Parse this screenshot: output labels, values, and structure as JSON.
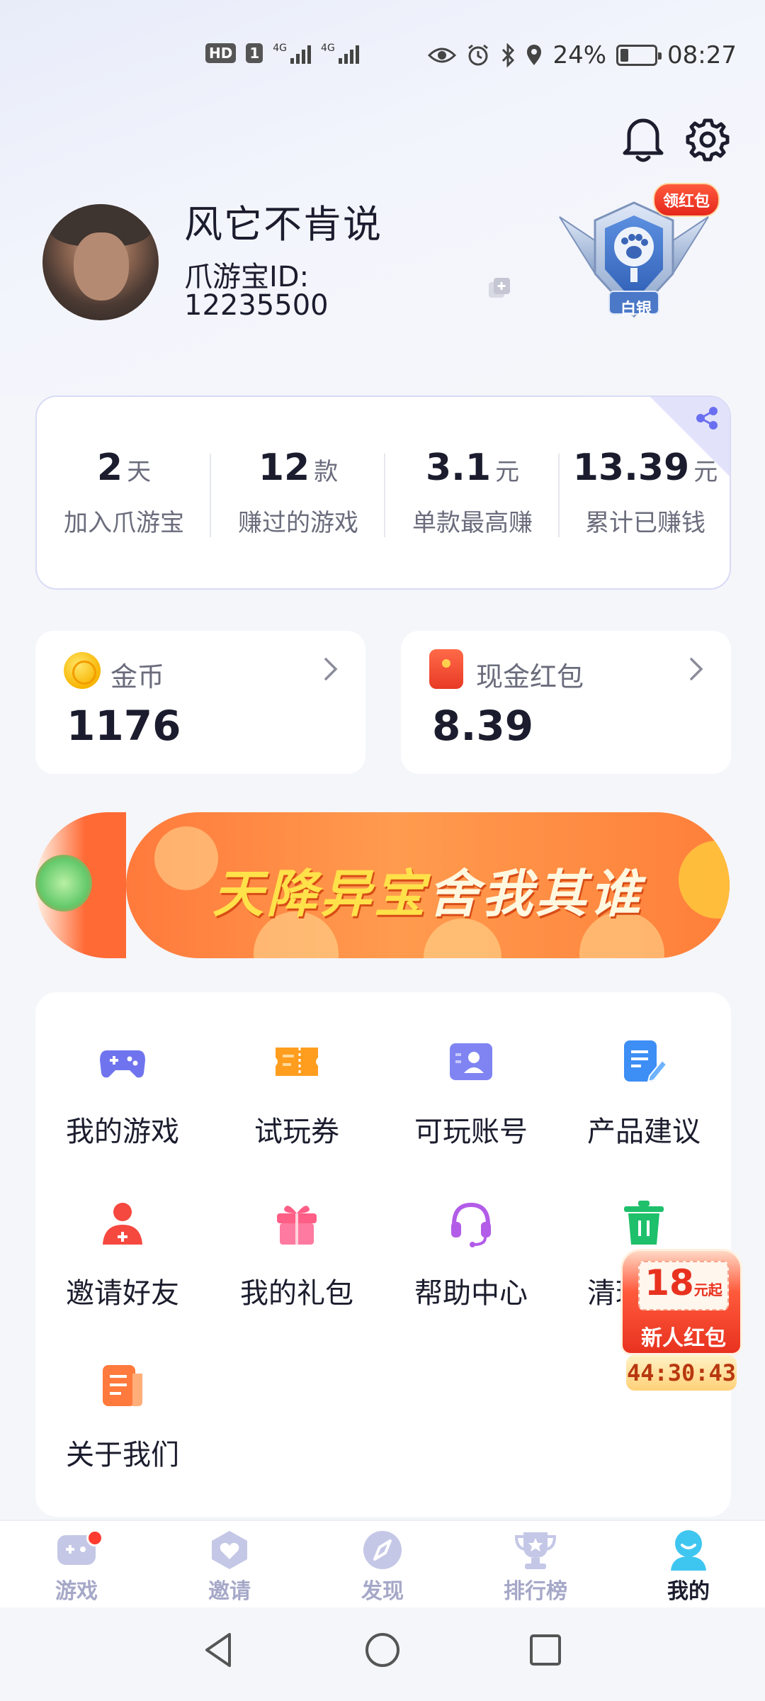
{
  "status_bar": {
    "hd": "HD",
    "sim": "1",
    "net1": "4G",
    "net2": "4G",
    "battery_text": "24%",
    "battery_level": 0.24,
    "time": "08:27"
  },
  "profile": {
    "username": "风它不肯说",
    "id_label": "爪游宝ID:",
    "id_value": "12235500",
    "badge_pill": "领红包",
    "badge_level": "白银"
  },
  "stats": [
    {
      "value": "2",
      "unit": "天",
      "label": "加入爪游宝"
    },
    {
      "value": "12",
      "unit": "款",
      "label": "赚过的游戏"
    },
    {
      "value": "3.1",
      "unit": "元",
      "label": "单款最高赚"
    },
    {
      "value": "13.39",
      "unit": "元",
      "label": "累计已赚钱"
    }
  ],
  "wallet": {
    "coins_title": "金币",
    "coins_value": "1176",
    "cash_title": "现金红包",
    "cash_value": "8.39"
  },
  "banner": {
    "text_yellow": "天降异宝",
    "text_white": "舍我其谁"
  },
  "menu": [
    {
      "label": "我的游戏",
      "icon": "gamepad-icon"
    },
    {
      "label": "试玩券",
      "icon": "ticket-icon"
    },
    {
      "label": "可玩账号",
      "icon": "account-card-icon"
    },
    {
      "label": "产品建议",
      "icon": "edit-document-icon"
    },
    {
      "label": "邀请好友",
      "icon": "invite-user-icon"
    },
    {
      "label": "我的礼包",
      "icon": "gift-icon"
    },
    {
      "label": "帮助中心",
      "icon": "headset-icon"
    },
    {
      "label": "清理缓存",
      "icon": "trash-icon"
    },
    {
      "label": "关于我们",
      "icon": "info-document-icon"
    }
  ],
  "float_pack": {
    "amount": "18",
    "amount_unit": "元起",
    "label": "新人红包",
    "timer": "44:30:43"
  },
  "bottom_nav": [
    {
      "label": "游戏",
      "icon": "game-icon"
    },
    {
      "label": "邀请",
      "icon": "heart-shield-icon"
    },
    {
      "label": "发现",
      "icon": "compass-icon"
    },
    {
      "label": "排行榜",
      "icon": "trophy-icon"
    },
    {
      "label": "我的",
      "icon": "profile-icon"
    }
  ],
  "colors": {
    "accent": "#7b7ff0",
    "text_dark": "#1b1d2e",
    "text_muted": "#6a6c7c",
    "banner_orange": "#ff8a45",
    "red": "#e8321f"
  }
}
